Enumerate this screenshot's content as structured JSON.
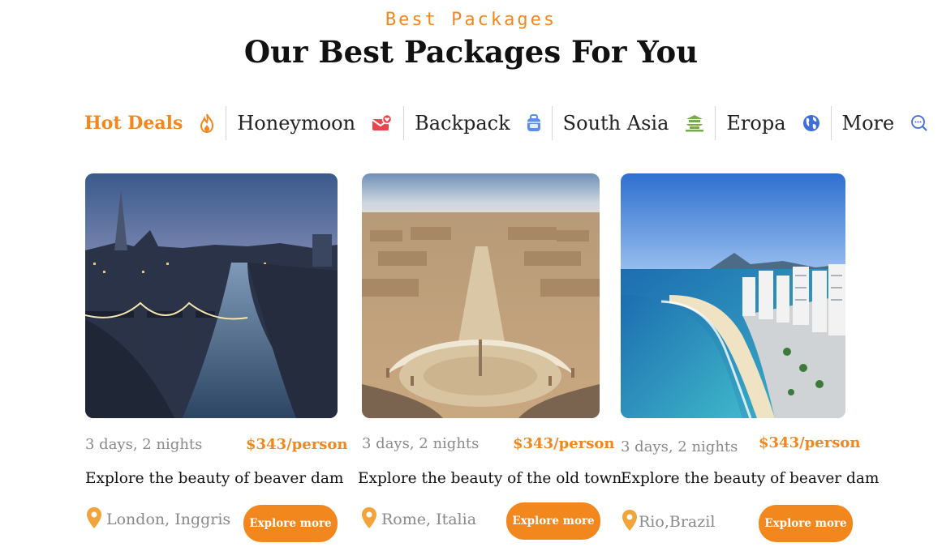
{
  "section": {
    "eyebrow": "Best Packages",
    "title": "Our Best Packages For You"
  },
  "tabs": [
    {
      "label": "Hot Deals",
      "icon": "flame-icon",
      "active": true
    },
    {
      "label": "Honeymoon",
      "icon": "love-letter-icon",
      "active": false
    },
    {
      "label": "Backpack",
      "icon": "backpack-icon",
      "active": false
    },
    {
      "label": "South Asia",
      "icon": "pagoda-icon",
      "active": false
    },
    {
      "label": "Eropa",
      "icon": "globe-icon",
      "active": false
    },
    {
      "label": "More",
      "icon": "search-more-icon",
      "active": false
    }
  ],
  "packages": [
    {
      "duration": "3 days, 2 nights",
      "price": "$343/person",
      "title": "Explore the beauty of beaver dam",
      "location": "London, Inggris",
      "button": "Explore more",
      "image": "london-city-photo"
    },
    {
      "duration": "3 days, 2 nights",
      "price": "$343/person",
      "title": "Explore the beauty of the old town",
      "location": "Rome, Italia",
      "button": "Explore more",
      "image": "rome-city-photo"
    },
    {
      "duration": "3 days, 2 nights",
      "price": "$343/person",
      "title": "Explore the beauty of beaver dam",
      "location": "Rio,Brazil",
      "button": "Explore more",
      "image": "rio-beach-photo"
    }
  ],
  "colors": {
    "accent": "#f2871e",
    "icon_blue": "#5b8ee6",
    "icon_green": "#7aa84c",
    "icon_red": "#e8464a"
  }
}
